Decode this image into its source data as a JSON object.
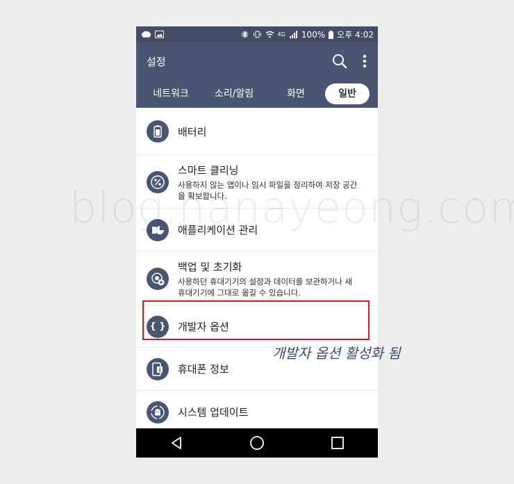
{
  "watermark": "blog.hanayeong.com",
  "status": {
    "network": "4G",
    "battery": "100%",
    "time": "오후 4:02"
  },
  "appbar": {
    "title": "설정"
  },
  "tabs": [
    {
      "label": "네트워크",
      "active": false
    },
    {
      "label": "소리/알림",
      "active": false
    },
    {
      "label": "화면",
      "active": false
    },
    {
      "label": "일반",
      "active": true
    }
  ],
  "items": [
    {
      "title": "배터리",
      "desc": "",
      "icon": "battery-icon"
    },
    {
      "title": "스마트 클리닝",
      "desc": "사용하지 않는 앱이나 임시 파일을 정리하여 저장 공간을 확보합니다.",
      "icon": "percent-icon"
    },
    {
      "title": "애플리케이션 관리",
      "desc": "",
      "icon": "pie-icon"
    },
    {
      "title": "백업 및 초기화",
      "desc": "사용하던 휴대기기의 설정과 데이터를 보관하거나 새 휴대기기에 그대로 옮길 수 있습니다.",
      "icon": "backup-icon"
    },
    {
      "title": "개발자 옵션",
      "desc": "",
      "icon": "braces-icon"
    },
    {
      "title": "휴대폰 정보",
      "desc": "",
      "icon": "phone-info-icon"
    },
    {
      "title": "시스템 업데이트",
      "desc": "",
      "icon": "android-icon"
    }
  ],
  "braces_glyph": "{ }",
  "annotation": "개발자 옵션 활성화 됨",
  "colors": {
    "header": "#4a5573",
    "status": "#434b66",
    "highlight": "#e0151b",
    "annotation": "#3a4a7a"
  }
}
